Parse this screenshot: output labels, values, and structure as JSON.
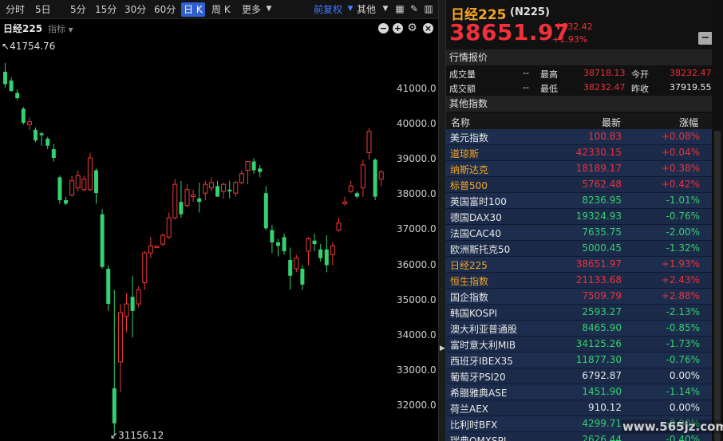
{
  "toolbar": {
    "periods": [
      "分时",
      "5日",
      "5分",
      "15分",
      "30分",
      "60分",
      "日 K",
      "周 K",
      "更多"
    ],
    "active_period": "日 K",
    "adjust_label": "前复权",
    "other_label": "其他"
  },
  "chart": {
    "name": "日经225",
    "indicator_label": "指标",
    "high_annotation": "41754.76",
    "low_annotation": "31156.12",
    "y_ticks": [
      "41000.0",
      "40000.0",
      "39000.0",
      "38000.0",
      "37000.0",
      "36000.0",
      "35000.0",
      "34000.0",
      "33000.0",
      "32000.0"
    ],
    "colors": {
      "up": "#f03a3a",
      "down": "#35d070",
      "background": "#000000"
    }
  },
  "chart_data": {
    "type": "candlestick",
    "ylim": [
      31000,
      42500
    ],
    "y_ticks": [
      41000,
      40000,
      39000,
      38000,
      37000,
      36000,
      35000,
      34000,
      33000,
      32000
    ],
    "candles": [
      {
        "o": 41500,
        "h": 41754.76,
        "l": 41050,
        "c": 41150
      },
      {
        "o": 41250,
        "h": 41350,
        "l": 40950,
        "c": 40950
      },
      {
        "o": 40900,
        "h": 41000,
        "l": 40700,
        "c": 40750
      },
      {
        "o": 40450,
        "h": 40500,
        "l": 40000,
        "c": 40050
      },
      {
        "o": 40000,
        "h": 40200,
        "l": 39850,
        "c": 40080
      },
      {
        "o": 39850,
        "h": 39920,
        "l": 39500,
        "c": 39550
      },
      {
        "o": 39750,
        "h": 39800,
        "l": 39400,
        "c": 39700
      },
      {
        "o": 39600,
        "h": 39650,
        "l": 39300,
        "c": 39400
      },
      {
        "o": 39300,
        "h": 39450,
        "l": 38950,
        "c": 39050
      },
      {
        "o": 38500,
        "h": 38550,
        "l": 37750,
        "c": 37850
      },
      {
        "o": 37850,
        "h": 37950,
        "l": 37700,
        "c": 37750
      },
      {
        "o": 38000,
        "h": 38550,
        "l": 37950,
        "c": 38400
      },
      {
        "o": 38200,
        "h": 38700,
        "l": 38100,
        "c": 38550
      },
      {
        "o": 38150,
        "h": 38550,
        "l": 38100,
        "c": 38450
      },
      {
        "o": 38150,
        "h": 39200,
        "l": 38100,
        "c": 39050
      },
      {
        "o": 38700,
        "h": 38750,
        "l": 37750,
        "c": 38050
      },
      {
        "o": 37450,
        "h": 37600,
        "l": 35900,
        "c": 35950
      },
      {
        "o": 35900,
        "h": 36000,
        "l": 34700,
        "c": 34900
      },
      {
        "o": 32500,
        "h": 35300,
        "l": 31156.12,
        "c": 31500
      },
      {
        "o": 33250,
        "h": 34900,
        "l": 32400,
        "c": 34650
      },
      {
        "o": 34550,
        "h": 35200,
        "l": 34100,
        "c": 34900
      },
      {
        "o": 35100,
        "h": 35700,
        "l": 33950,
        "c": 34700
      },
      {
        "o": 34900,
        "h": 35400,
        "l": 34800,
        "c": 35300
      },
      {
        "o": 35500,
        "h": 36400,
        "l": 35300,
        "c": 36350
      },
      {
        "o": 36350,
        "h": 36800,
        "l": 36200,
        "c": 36550
      },
      {
        "o": 36500,
        "h": 36500,
        "l": 36500,
        "c": 36550
      },
      {
        "o": 36600,
        "h": 36900,
        "l": 36550,
        "c": 36850
      },
      {
        "o": 36800,
        "h": 37500,
        "l": 36750,
        "c": 37350
      },
      {
        "o": 37350,
        "h": 38450,
        "l": 37300,
        "c": 38300
      },
      {
        "o": 37800,
        "h": 38400,
        "l": 37350,
        "c": 37450
      },
      {
        "o": 37700,
        "h": 38300,
        "l": 37650,
        "c": 38150
      },
      {
        "o": 37950,
        "h": 38150,
        "l": 37800,
        "c": 38000
      },
      {
        "o": 37900,
        "h": 38350,
        "l": 37500,
        "c": 37800
      },
      {
        "o": 38050,
        "h": 38400,
        "l": 37850,
        "c": 38300
      },
      {
        "o": 38200,
        "h": 38500,
        "l": 38100,
        "c": 38350
      },
      {
        "o": 38250,
        "h": 38400,
        "l": 37950,
        "c": 37950
      },
      {
        "o": 38100,
        "h": 38350,
        "l": 37900,
        "c": 38300
      },
      {
        "o": 38150,
        "h": 38400,
        "l": 37900,
        "c": 38100
      },
      {
        "o": 38050,
        "h": 38400,
        "l": 37950,
        "c": 38350
      },
      {
        "o": 38350,
        "h": 38700,
        "l": 38300,
        "c": 38600
      },
      {
        "o": 38700,
        "h": 38950,
        "l": 38300,
        "c": 38950
      },
      {
        "o": 38950,
        "h": 39050,
        "l": 38600,
        "c": 38700
      },
      {
        "o": 38750,
        "h": 38850,
        "l": 38500,
        "c": 38650
      },
      {
        "o": 38050,
        "h": 38250,
        "l": 37000,
        "c": 37050
      },
      {
        "o": 37000,
        "h": 37150,
        "l": 36350,
        "c": 36650
      },
      {
        "o": 36650,
        "h": 36750,
        "l": 36250,
        "c": 36550
      },
      {
        "o": 36800,
        "h": 36900,
        "l": 36300,
        "c": 36400
      },
      {
        "o": 36150,
        "h": 36500,
        "l": 35300,
        "c": 35700
      },
      {
        "o": 35900,
        "h": 36300,
        "l": 35800,
        "c": 36200
      },
      {
        "o": 35900,
        "h": 36000,
        "l": 35300,
        "c": 35450
      },
      {
        "o": 36400,
        "h": 36800,
        "l": 36000,
        "c": 36750
      },
      {
        "o": 36700,
        "h": 36900,
        "l": 36400,
        "c": 36600
      },
      {
        "o": 36450,
        "h": 36600,
        "l": 36100,
        "c": 36200
      },
      {
        "o": 36450,
        "h": 36850,
        "l": 35800,
        "c": 36000
      },
      {
        "o": 36300,
        "h": 36650,
        "l": 36000,
        "c": 36550
      },
      {
        "o": 37000,
        "h": 37350,
        "l": 36950,
        "c": 37200
      },
      {
        "o": 37750,
        "h": 37950,
        "l": 37700,
        "c": 37800
      },
      {
        "o": 38100,
        "h": 38400,
        "l": 38050,
        "c": 38250
      },
      {
        "o": 38050,
        "h": 38100,
        "l": 37900,
        "c": 37950
      },
      {
        "o": 38200,
        "h": 39000,
        "l": 37950,
        "c": 38850
      },
      {
        "o": 39200,
        "h": 39900,
        "l": 39000,
        "c": 39800
      },
      {
        "o": 39000,
        "h": 39050,
        "l": 37850,
        "c": 37950
      },
      {
        "o": 38450,
        "h": 38700,
        "l": 38250,
        "c": 38651.97
      }
    ]
  },
  "quote": {
    "name": "日经225",
    "code": "(N225)",
    "price": "38651.97",
    "change": "732.42",
    "change_arrow": "⬆",
    "pct": "+1.93%"
  },
  "market_section": {
    "title": "行情报价",
    "rows": [
      {
        "label": "成交量",
        "dash": "--",
        "label2": "最高",
        "val2": "38718.13",
        "label3": "今开",
        "val3": "38232.47"
      },
      {
        "label": "成交额",
        "dash": "--",
        "label2": "最低",
        "val2": "38232.47",
        "label3": "昨收",
        "val3": "37919.55"
      }
    ]
  },
  "indices_section": {
    "title": "其他指数",
    "headers": {
      "name": "名称",
      "price": "最新",
      "pct": "涨幅"
    },
    "rows": [
      {
        "name": "美元指数",
        "price": "100.83",
        "pct": "+0.08%",
        "dir": "up",
        "highlight": false
      },
      {
        "name": "道琼斯",
        "price": "42330.15",
        "pct": "+0.04%",
        "dir": "up",
        "highlight": true
      },
      {
        "name": "纳斯达克",
        "price": "18189.17",
        "pct": "+0.38%",
        "dir": "up",
        "highlight": true
      },
      {
        "name": "标普500",
        "price": "5762.48",
        "pct": "+0.42%",
        "dir": "up",
        "highlight": true
      },
      {
        "name": "英国富时100",
        "price": "8236.95",
        "pct": "-1.01%",
        "dir": "down",
        "highlight": false
      },
      {
        "name": "德国DAX30",
        "price": "19324.93",
        "pct": "-0.76%",
        "dir": "down",
        "highlight": false
      },
      {
        "name": "法国CAC40",
        "price": "7635.75",
        "pct": "-2.00%",
        "dir": "down",
        "highlight": false
      },
      {
        "name": "欧洲斯托克50",
        "price": "5000.45",
        "pct": "-1.32%",
        "dir": "down",
        "highlight": false
      },
      {
        "name": "日经225",
        "price": "38651.97",
        "pct": "+1.93%",
        "dir": "up",
        "highlight": true
      },
      {
        "name": "恒生指数",
        "price": "21133.68",
        "pct": "+2.43%",
        "dir": "up",
        "highlight": true
      },
      {
        "name": "国企指数",
        "price": "7509.79",
        "pct": "+2.88%",
        "dir": "up",
        "highlight": false
      },
      {
        "name": "韩国KOSPI",
        "price": "2593.27",
        "pct": "-2.13%",
        "dir": "down",
        "highlight": false
      },
      {
        "name": "澳大利亚普通股",
        "price": "8465.90",
        "pct": "-0.85%",
        "dir": "down",
        "highlight": false
      },
      {
        "name": "富时意大利MIB",
        "price": "34125.26",
        "pct": "-1.73%",
        "dir": "down",
        "highlight": false
      },
      {
        "name": "西班牙IBEX35",
        "price": "11877.30",
        "pct": "-0.76%",
        "dir": "down",
        "highlight": false
      },
      {
        "name": "葡萄牙PSI20",
        "price": "6792.87",
        "pct": "0.00%",
        "dir": "flat",
        "highlight": false
      },
      {
        "name": "希腊雅典ASE",
        "price": "1451.90",
        "pct": "-1.14%",
        "dir": "down",
        "highlight": false
      },
      {
        "name": "荷兰AEX",
        "price": "910.12",
        "pct": "0.00%",
        "dir": "flat",
        "highlight": false
      },
      {
        "name": "比利时BFX",
        "price": "4299.71",
        "pct": "-0.90%",
        "dir": "down",
        "highlight": false
      },
      {
        "name": "瑞典OMXSPI",
        "price": "2626.44",
        "pct": "-0.40%",
        "dir": "down",
        "highlight": false
      }
    ],
    "row_bg": "#1c2d4d",
    "row_bg_alt": "#1a2a48"
  },
  "watermark": "www.565jz.com"
}
